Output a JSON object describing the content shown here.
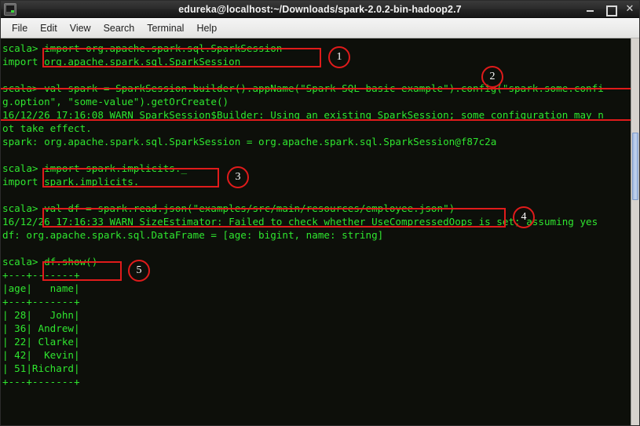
{
  "window": {
    "title": "edureka@localhost:~/Downloads/spark-2.0.2-bin-hadoop2.7",
    "icon": "terminal-icon",
    "buttons": {
      "minimize": "minimize-icon",
      "maximize": "maximize-icon",
      "close": "✕"
    }
  },
  "menubar": {
    "items": [
      {
        "label": "File"
      },
      {
        "label": "Edit"
      },
      {
        "label": "View"
      },
      {
        "label": "Search"
      },
      {
        "label": "Terminal"
      },
      {
        "label": "Help"
      }
    ]
  },
  "terminal": {
    "prompt": "scala>",
    "foreground": "#2fe62f",
    "background": "#0d0f0a",
    "lines": [
      "scala> import org.apache.spark.sql.SparkSession",
      "import org.apache.spark.sql.SparkSession",
      "",
      "scala> val spark = SparkSession.builder().appName(\"Spark SQL basic example\").config(\"spark.some.confi",
      "g.option\", \"some-value\").getOrCreate()",
      "16/12/26 17:16:08 WARN SparkSession$Builder: Using an existing SparkSession; some configuration may n",
      "ot take effect.",
      "spark: org.apache.spark.sql.SparkSession = org.apache.spark.sql.SparkSession@f87c2a",
      "",
      "scala> import spark.implicits._",
      "import spark.implicits._",
      "",
      "scala> val df = spark.read.json(\"examples/src/main/resources/employee.json\")",
      "16/12/26 17:16:33 WARN SizeEstimator: Failed to check whether UseCompressedOops is set; assuming yes",
      "df: org.apache.spark.sql.DataFrame = [age: bigint, name: string]",
      "",
      "scala> df.show()",
      "+---+-------+",
      "|age|   name|",
      "+---+-------+",
      "| 28|   John|",
      "| 36| Andrew|",
      "| 22| Clarke|",
      "| 42|  Kevin|",
      "| 51|Richard|",
      "+---+-------+"
    ]
  },
  "dataframe": {
    "columns": [
      "age",
      "name"
    ],
    "rows": [
      {
        "age": "28",
        "name": "John"
      },
      {
        "age": "36",
        "name": "Andrew"
      },
      {
        "age": "22",
        "name": "Clarke"
      },
      {
        "age": "42",
        "name": "Kevin"
      },
      {
        "age": "51",
        "name": "Richard"
      }
    ]
  },
  "annotations": {
    "color": "#e01b1b",
    "callouts": [
      {
        "number": "1",
        "target": "import-sparksession-command"
      },
      {
        "number": "2",
        "target": "sparksession-builder-command"
      },
      {
        "number": "3",
        "target": "import-implicits-command"
      },
      {
        "number": "4",
        "target": "read-json-command"
      },
      {
        "number": "5",
        "target": "df-show-command"
      }
    ]
  },
  "scrollbar": {
    "orientation": "vertical"
  }
}
